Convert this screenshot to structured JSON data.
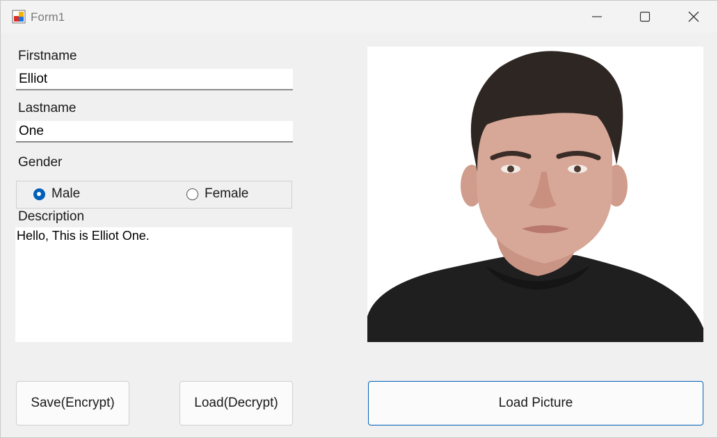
{
  "window": {
    "title": "Form1",
    "icon": "winforms-app-icon",
    "controls": [
      "minimize-icon",
      "maximize-icon",
      "close-icon"
    ]
  },
  "form": {
    "firstname_label": "Firstname",
    "firstname_value": "Elliot",
    "lastname_label": "Lastname",
    "lastname_value": "One",
    "gender_label": "Gender",
    "gender_options": [
      {
        "label": "Male",
        "checked": true
      },
      {
        "label": "Female",
        "checked": false
      }
    ],
    "description_label": "Description",
    "description_value": "Hello, This is Elliot One."
  },
  "picture": {
    "icon": "portrait-photo"
  },
  "buttons": {
    "save_label": "Save(Encrypt)",
    "load_label": "Load(Decrypt)",
    "load_picture_label": "Load Picture"
  },
  "colors": {
    "accent": "#005fb8",
    "window_bg": "#f0f0f0",
    "shirt": "#1f1f1f",
    "hair": "#2e2622",
    "skin": "#d7a898"
  }
}
